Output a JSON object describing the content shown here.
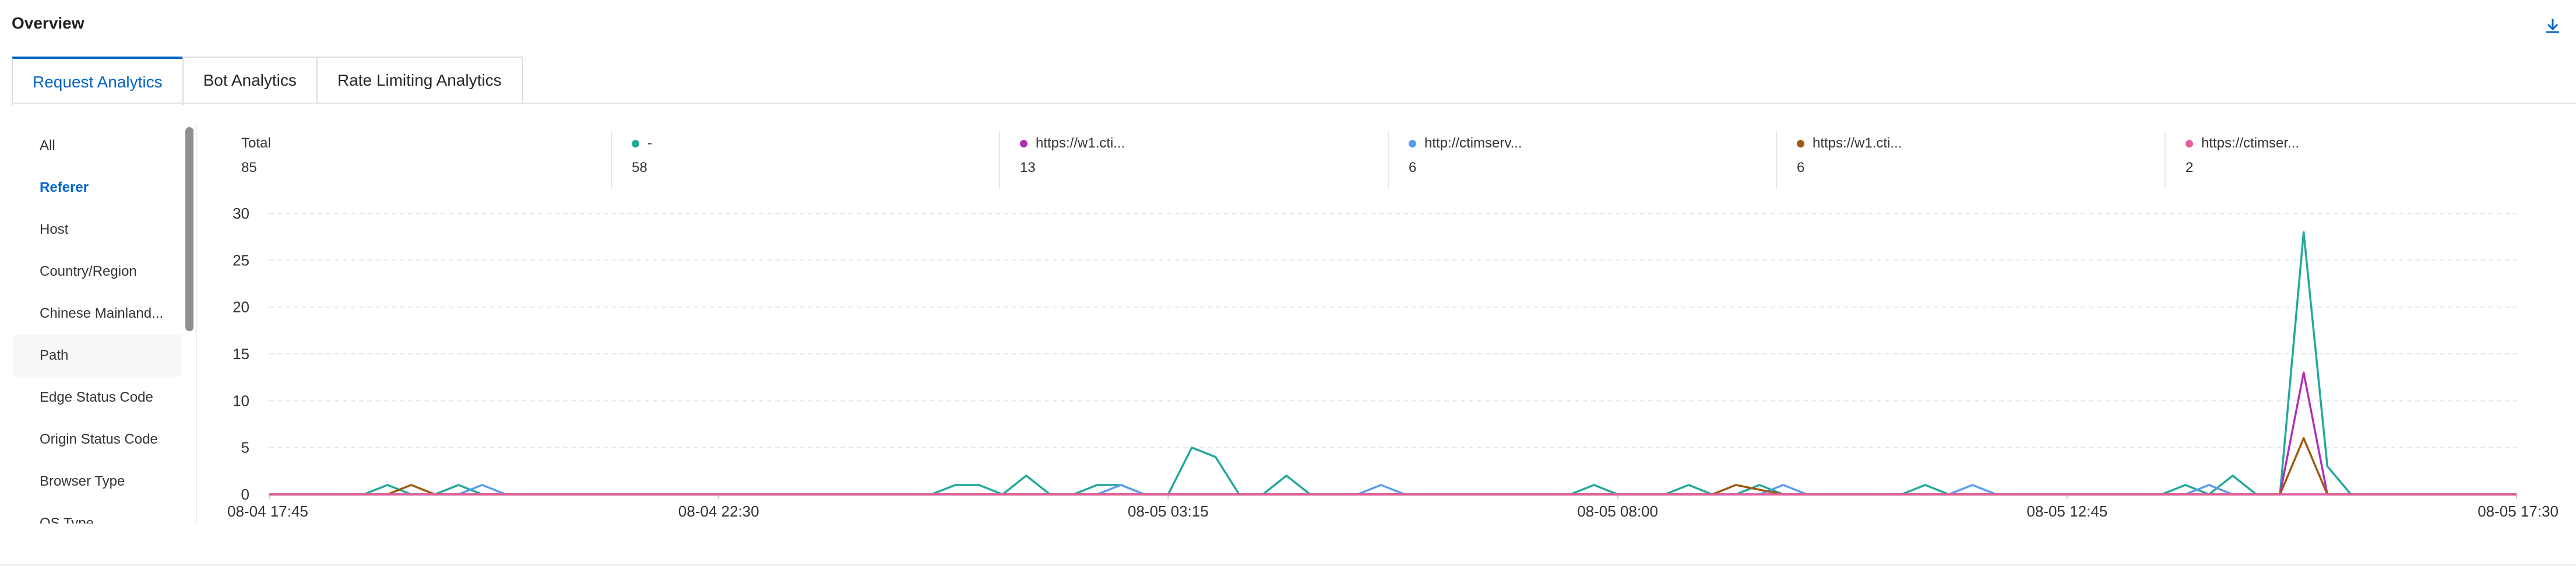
{
  "header": {
    "title": "Overview",
    "download_icon": "download-icon"
  },
  "tabs": [
    {
      "label": "Request Analytics",
      "active": true
    },
    {
      "label": "Bot Analytics",
      "active": false
    },
    {
      "label": "Rate Limiting Analytics",
      "active": false
    }
  ],
  "sidebar": {
    "items": [
      {
        "label": "All"
      },
      {
        "label": "Referer",
        "active": true
      },
      {
        "label": "Host"
      },
      {
        "label": "Country/Region"
      },
      {
        "label": "Chinese Mainland..."
      },
      {
        "label": "Path"
      },
      {
        "label": "Edge Status Code"
      },
      {
        "label": "Origin Status Code"
      },
      {
        "label": "Browser Type"
      },
      {
        "label": "OS Type"
      }
    ]
  },
  "stats": [
    {
      "label": "Total",
      "value": "85",
      "color": ""
    },
    {
      "label": "-",
      "value": "58",
      "color": "#22a89a"
    },
    {
      "label": "https://w1.cti...",
      "value": "13",
      "color": "#b02fb8"
    },
    {
      "label": "http://ctimserv...",
      "value": "6",
      "color": "#5b9bf0"
    },
    {
      "label": "https://w1.cti...",
      "value": "6",
      "color": "#9c5a12"
    },
    {
      "label": "https://ctimser...",
      "value": "2",
      "color": "#e85d9b"
    }
  ],
  "chart_data": {
    "type": "line",
    "ylim": [
      0,
      30
    ],
    "yticks": [
      0,
      5,
      10,
      15,
      20,
      25,
      30
    ],
    "xticks": [
      "08-04 17:45",
      "08-04 22:30",
      "08-05 03:15",
      "08-05 08:00",
      "08-05 12:45",
      "08-05 17:30"
    ],
    "x_count": 96,
    "grid": true,
    "series": [
      {
        "name": "-",
        "color": "#22a89a",
        "points": [
          [
            5,
            1
          ],
          [
            8,
            1
          ],
          [
            29,
            1
          ],
          [
            30,
            1
          ],
          [
            32,
            2
          ],
          [
            35,
            1
          ],
          [
            36,
            1
          ],
          [
            39,
            5
          ],
          [
            40,
            4
          ],
          [
            43,
            2
          ],
          [
            56,
            1
          ],
          [
            60,
            1
          ],
          [
            63,
            1
          ],
          [
            70,
            1
          ],
          [
            81,
            1
          ],
          [
            83,
            2
          ],
          [
            86,
            28
          ],
          [
            87,
            3
          ]
        ]
      },
      {
        "name": "https://w1.cti...",
        "color": "#b02fb8",
        "points": [
          [
            86,
            13
          ]
        ]
      },
      {
        "name": "http://ctimserv...",
        "color": "#5b9bf0",
        "points": [
          [
            9,
            1
          ],
          [
            36,
            1
          ],
          [
            47,
            1
          ],
          [
            64,
            1
          ],
          [
            72,
            1
          ],
          [
            82,
            1
          ]
        ]
      },
      {
        "name": "https://w1.cti...",
        "color": "#9c5a12",
        "points": [
          [
            6,
            1
          ],
          [
            62,
            1
          ],
          [
            63,
            0.5
          ],
          [
            86,
            6
          ]
        ]
      },
      {
        "name": "https://ctimser...",
        "color": "#e85d9b",
        "points": []
      }
    ]
  }
}
